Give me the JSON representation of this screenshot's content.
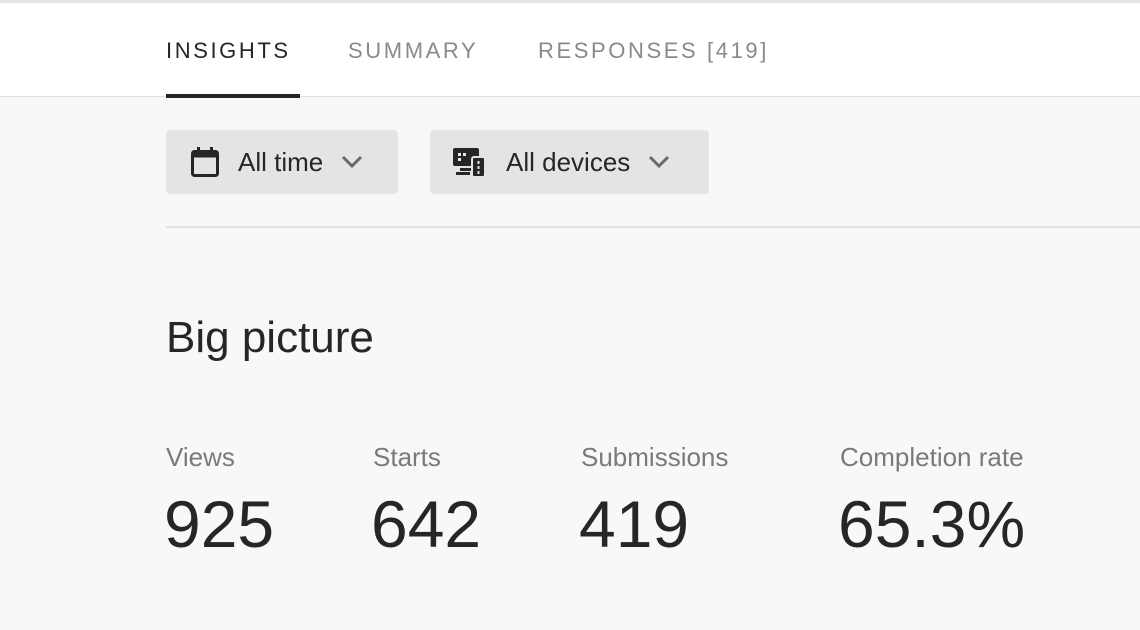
{
  "tabs": [
    {
      "label": "INSIGHTS",
      "active": true
    },
    {
      "label": "SUMMARY",
      "active": false
    },
    {
      "label": "RESPONSES [419]",
      "active": false
    }
  ],
  "filters": {
    "time": {
      "label": "All time",
      "icon": "calendar-icon"
    },
    "device": {
      "label": "All devices",
      "icon": "devices-icon"
    }
  },
  "section": {
    "title": "Big picture"
  },
  "stats": [
    {
      "label": "Views",
      "value": "925"
    },
    {
      "label": "Starts",
      "value": "642"
    },
    {
      "label": "Submissions",
      "value": "419"
    },
    {
      "label": "Completion rate",
      "value": "65.3%"
    }
  ],
  "colors": {
    "text": "#262627",
    "muted": "#8a8a8a",
    "filter_bg": "#e4e4e4",
    "page_bg": "#f8f8f8"
  }
}
